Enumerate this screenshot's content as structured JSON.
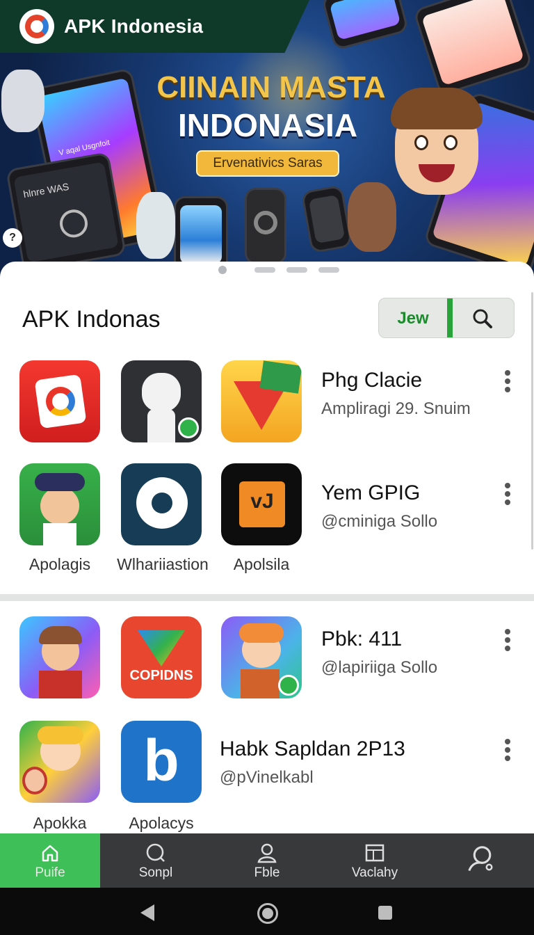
{
  "header": {
    "brand_title": "APK Indonesia"
  },
  "hero": {
    "headline_line1": "CIINAIN MASTA",
    "headline_line2": "INDONASIA",
    "pill_label": "Ervenativics Saras",
    "phone_screen_text": "V aqal Usgnfoit",
    "phone_screen_text2": "hlnre WAS",
    "indicators": 4,
    "active_indicator": 0
  },
  "section": {
    "title": "APK Indonas",
    "segment_new_label": "Jew"
  },
  "icon_texts": {
    "copidns": "COPIDNS",
    "vj": "vJ",
    "b": "b"
  },
  "rows": [
    {
      "title": "Phg Clacie",
      "subtitle": "Ampliragi 29. Snuim"
    },
    {
      "title": "Yem GPIG",
      "subtitle": "@cminiga Sollo"
    },
    {
      "title": "Pbk: 411",
      "subtitle": "@lapiriiga Sollo"
    },
    {
      "title": "Habk Sapldan 2P13",
      "subtitle": "@pVinelkabl"
    }
  ],
  "app_labels": [
    "Apolagis",
    "Wlhariiastion",
    "Apolsila",
    "Apokka",
    "Apolacys"
  ],
  "bottom_nav": [
    {
      "label": "Puife",
      "icon": "home-icon"
    },
    {
      "label": "Sonpl",
      "icon": "search-icon"
    },
    {
      "label": "Fble",
      "icon": "profile-icon"
    },
    {
      "label": "Vaclahy",
      "icon": "gallery-icon"
    },
    {
      "label": "",
      "icon": "account-icon"
    }
  ],
  "colors": {
    "accent": "#3fbf57",
    "brand_bar": "#0f3a2a",
    "nav_bg": "#38393b"
  }
}
